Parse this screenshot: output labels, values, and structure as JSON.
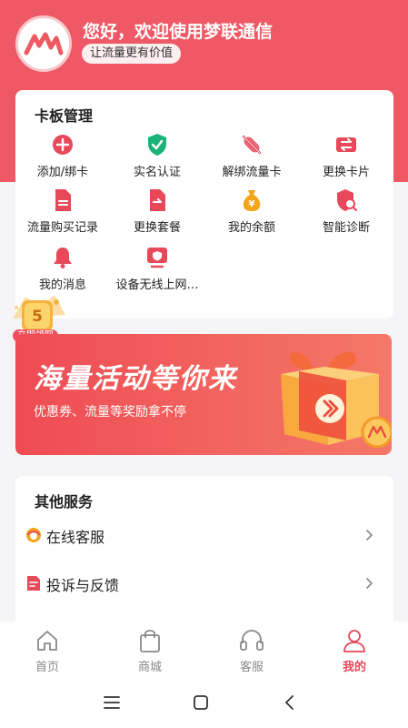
{
  "header": {
    "greeting": "您好，欢迎使用梦联通信",
    "slogan": "让流量更有价值"
  },
  "card_management": {
    "title": "卡板管理",
    "items": [
      {
        "label": "添加/绑卡",
        "icon": "plus-circle-icon"
      },
      {
        "label": "实名认证",
        "icon": "shield-check-icon"
      },
      {
        "label": "解绑流量卡",
        "icon": "unbind-icon"
      },
      {
        "label": "更换卡片",
        "icon": "swap-card-icon"
      },
      {
        "label": "流量购买记录",
        "icon": "document-icon"
      },
      {
        "label": "更换套餐",
        "icon": "switch-plan-icon"
      },
      {
        "label": "我的余额",
        "icon": "money-bag-icon"
      },
      {
        "label": "智能诊断",
        "icon": "diagnose-shield-icon"
      },
      {
        "label": "我的消息",
        "icon": "bell-icon"
      },
      {
        "label": "设备无线上网…",
        "icon": "monitor-icon"
      }
    ]
  },
  "claim": {
    "tag": "立即领取",
    "badge_number": "5"
  },
  "banner": {
    "title": "海量活动等你来",
    "subtitle": "优惠券、流量等奖励拿不停"
  },
  "services": {
    "title": "其他服务",
    "items": [
      {
        "label": "在线客服",
        "icon": "headset-icon"
      },
      {
        "label": "投诉与反馈",
        "icon": "feedback-icon"
      }
    ]
  },
  "tabbar": {
    "items": [
      {
        "label": "首页",
        "icon": "home-icon"
      },
      {
        "label": "商城",
        "icon": "shopping-bag-icon"
      },
      {
        "label": "客服",
        "icon": "headphones-icon"
      },
      {
        "label": "我的",
        "icon": "user-icon",
        "active": true
      }
    ]
  },
  "colors": {
    "brand_red": "#ef5965",
    "active_tab": "#e8495a",
    "icon_red": "#e8495a",
    "icon_green": "#19b37a",
    "icon_orange": "#f4a51c"
  }
}
